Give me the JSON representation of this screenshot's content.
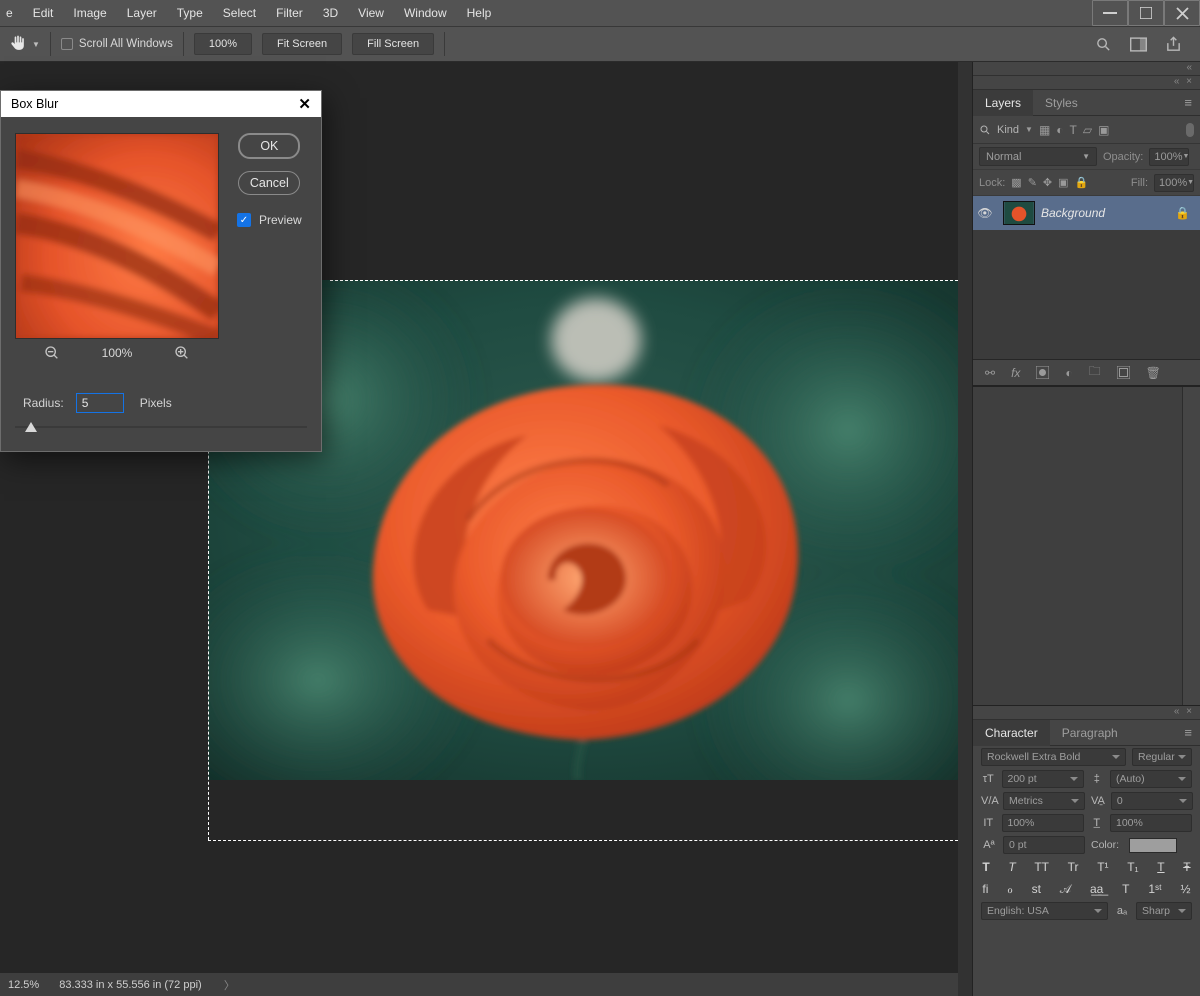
{
  "menubar": {
    "items": [
      "e",
      "Edit",
      "Image",
      "Layer",
      "Type",
      "Select",
      "Filter",
      "3D",
      "View",
      "Window",
      "Help"
    ]
  },
  "optbar": {
    "scroll_all": "Scroll All Windows",
    "zoom": "100%",
    "fit": "Fit Screen",
    "fill": "Fill Screen"
  },
  "dialog": {
    "title": "Box Blur",
    "ok": "OK",
    "cancel": "Cancel",
    "preview": "Preview",
    "preview_checked": true,
    "zoom": "100%",
    "radius_label": "Radius:",
    "radius_value": "5",
    "radius_unit": "Pixels"
  },
  "layers_panel": {
    "tab_layers": "Layers",
    "tab_styles": "Styles",
    "kind": "Kind",
    "blend": "Normal",
    "opacity_label": "Opacity:",
    "opacity": "100%",
    "lock_label": "Lock:",
    "fill_label": "Fill:",
    "fill": "100%",
    "layer_name": "Background"
  },
  "character_panel": {
    "tab_char": "Character",
    "tab_para": "Paragraph",
    "font": "Rockwell Extra Bold",
    "style": "Regular",
    "size": "200 pt",
    "leading": "(Auto)",
    "kerning": "Metrics",
    "tracking": "0",
    "vscale": "100%",
    "hscale": "100%",
    "baseline": "0 pt",
    "color_label": "Color:",
    "ot_top": [
      "T",
      "T",
      "TT",
      "Tr",
      "T¹",
      "T₁",
      "T",
      "Ŧ"
    ],
    "ot_bot": [
      "fi",
      "ℴ",
      "st",
      "𝒜",
      "a͟a͟",
      "T",
      "1ˢᵗ",
      "½"
    ],
    "lang": "English: USA",
    "aa": "Sharp",
    "aa_icon": "aₐ"
  },
  "statusbar": {
    "zoom": "12.5%",
    "info": "83.333 in x 55.556 in (72 ppi)"
  }
}
